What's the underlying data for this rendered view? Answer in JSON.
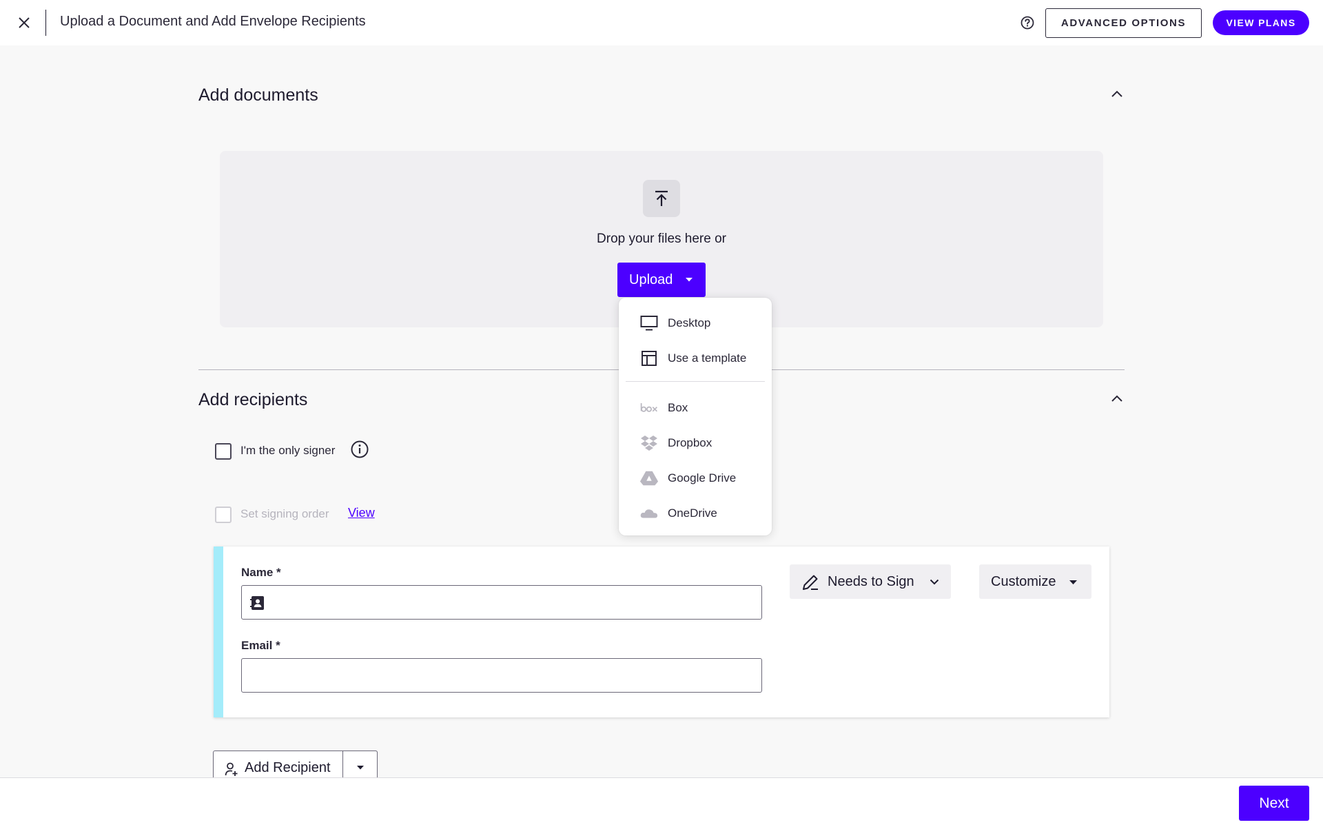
{
  "header": {
    "title": "Upload a Document and Add Envelope Recipients",
    "advanced_label": "ADVANCED OPTIONS",
    "plans_label": "VIEW PLANS"
  },
  "documents": {
    "section_title": "Add documents",
    "drop_text": "Drop your files here or",
    "upload_label": "Upload",
    "menu": [
      {
        "label": "Desktop",
        "icon": "monitor-icon"
      },
      {
        "label": "Use a template",
        "icon": "template-icon"
      },
      {
        "label": "Box",
        "icon": "box-logo-icon"
      },
      {
        "label": "Dropbox",
        "icon": "dropbox-logo-icon"
      },
      {
        "label": "Google Drive",
        "icon": "google-drive-logo-icon"
      },
      {
        "label": "OneDrive",
        "icon": "onedrive-logo-icon"
      }
    ]
  },
  "recipients": {
    "section_title": "Add recipients",
    "only_signer_label": "I'm the only signer",
    "signing_order_label": "Set signing order",
    "view_link": "View",
    "card": {
      "name_label": "Name *",
      "name_value": "",
      "email_label": "Email *",
      "email_value": "",
      "role_label": "Needs to Sign",
      "customize_label": "Customize"
    },
    "add_recipient_label": "Add Recipient"
  },
  "footer": {
    "next_label": "Next"
  },
  "colors": {
    "accent": "#4c00ff",
    "card_stripe": "#a4ecfa",
    "dropzone": "#f0eff2"
  }
}
